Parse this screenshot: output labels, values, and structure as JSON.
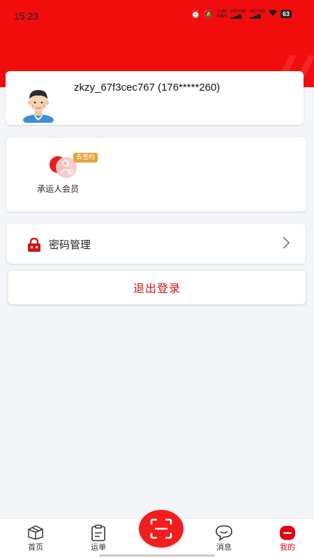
{
  "status_bar": {
    "time": "15:23",
    "speed_top": "2.80",
    "speed_bottom": "KB/s",
    "signal_1": "HD HD",
    "signal_2": "HD HD",
    "battery": "63"
  },
  "profile": {
    "username": "zkzy_67f3cec767 (176*****260)"
  },
  "member": {
    "badge": "去签约",
    "label": "承运人会员"
  },
  "password": {
    "label": "密码管理"
  },
  "logout": {
    "label": "退出登录"
  },
  "tabbar": {
    "items": [
      {
        "label": "首页",
        "icon": "box-icon"
      },
      {
        "label": "运单",
        "icon": "clipboard-icon"
      },
      {
        "label": "",
        "icon": "scan-icon"
      },
      {
        "label": "消息",
        "icon": "chat-bubble-icon"
      },
      {
        "label": "我的",
        "icon": "profile-icon"
      }
    ]
  },
  "colors": {
    "accent": "#f20d0d",
    "logout_text": "#d01515",
    "badge": "#e8a33b"
  }
}
